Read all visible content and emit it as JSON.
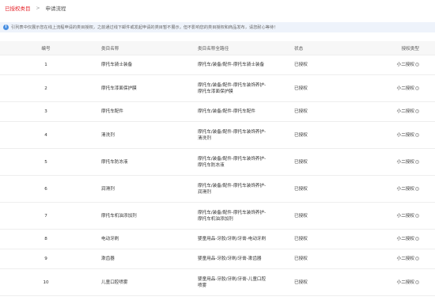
{
  "breadcrumb": {
    "parent": "已授权类目",
    "separator": ">",
    "current": "申请流程"
  },
  "notice": {
    "icon": "info-icon",
    "text": "引列表中仅展示您在线上流程申请的类目授权，之前通过线下邮件或发起申请的类目暂不展示，但不影响您的类目授权和商品发布，请您耐心等待！"
  },
  "table": {
    "headers": {
      "idx": "编号",
      "name": "类目名称",
      "path": "类目名称全路径",
      "status": "状态",
      "type": "授权类型"
    },
    "rows": [
      {
        "idx": "1",
        "name": "摩托车骑士装备",
        "path": [
          "摩托车/装备/配件-摩托车骑士装备"
        ],
        "status": "已授权",
        "type": "小二授权"
      },
      {
        "idx": "2",
        "name": "摩托车漆面保护膜",
        "path": [
          "摩托车/装备/配件-摩托车装饰养护-",
          "摩托车漆面保护膜"
        ],
        "status": "已授权",
        "type": "小二授权"
      },
      {
        "idx": "3",
        "name": "摩托车配件",
        "path": [
          "摩托车/装备/配件-摩托车配件"
        ],
        "status": "已授权",
        "type": "小二授权"
      },
      {
        "idx": "4",
        "name": "清洗剂",
        "path": [
          "摩托车/装备/配件-摩托车装饰养护-",
          "清洗剂"
        ],
        "status": "已授权",
        "type": "小二授权"
      },
      {
        "idx": "5",
        "name": "摩托车防冻液",
        "path": [
          "摩托车/装备/配件-摩托车装饰养护-",
          "摩托车防冻液"
        ],
        "status": "已授权",
        "type": "小二授权"
      },
      {
        "idx": "6",
        "name": "润滑剂",
        "path": [
          "摩托车/装备/配件-摩托车装饰养护-",
          "润滑剂"
        ],
        "status": "已授权",
        "type": "小二授权"
      },
      {
        "idx": "7",
        "name": "摩托车机油添加剂",
        "path": [
          "摩托车/装备/配件-摩托车装饰养护-",
          "摩托车机油添加剂"
        ],
        "status": "已授权",
        "type": "小二授权"
      },
      {
        "idx": "8",
        "name": "电动牙刷",
        "path": [
          "婴童用品-牙胶/牙刷/牙膏-电动牙刷"
        ],
        "status": "已授权",
        "type": "小二授权"
      },
      {
        "idx": "9",
        "name": "漱齿器",
        "path": [
          "婴童用品-牙胶/牙刷/牙膏-漱齿器"
        ],
        "status": "已授权",
        "type": "小二授权"
      },
      {
        "idx": "10",
        "name": "儿童口腔喷雾",
        "path": [
          "婴童用品-牙胶/牙刷/牙膏-儿童口腔",
          "喷雾"
        ],
        "status": "已授权",
        "type": "小二授权"
      }
    ]
  },
  "colors": {
    "accent": "#e5262c",
    "notice_bg": "#eef3fb",
    "info": "#4a90e2"
  }
}
